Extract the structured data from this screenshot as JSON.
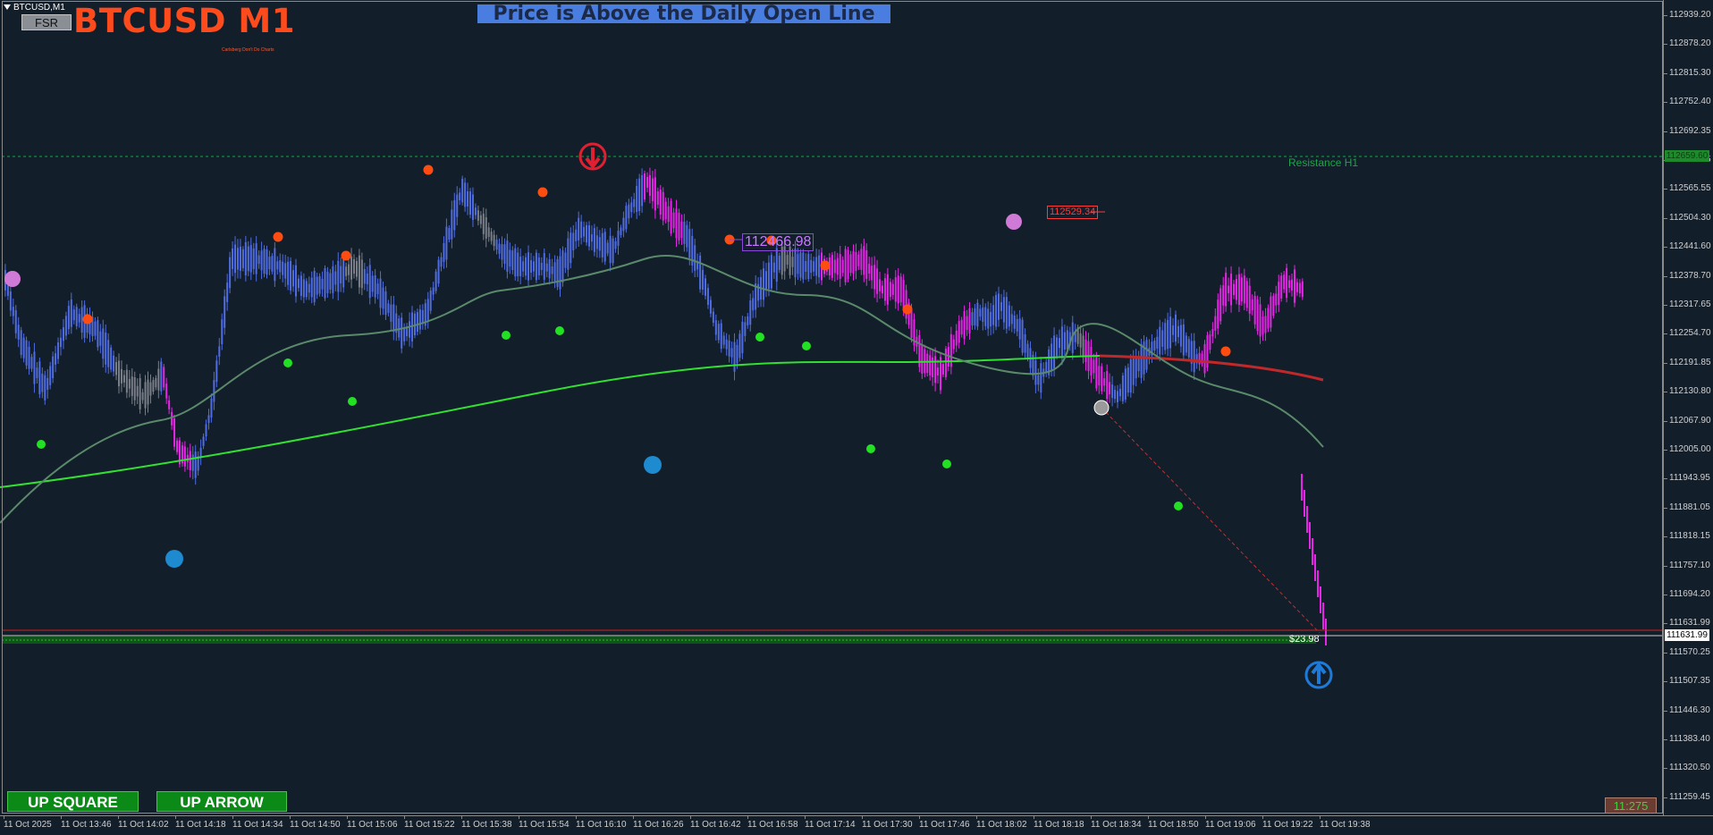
{
  "window": {
    "symbol_tab": "BTCUSD,M1",
    "fsr_button": "FSR",
    "title": "BTCUSD M1",
    "subtitle": "Carlsberg Don't Do Charts",
    "status_banner": "Price is Above the Daily Open Line"
  },
  "annotations": {
    "resistance_label": "Resistance H1",
    "price_label_1": "112466.98",
    "price_label_2": "112529.34",
    "profit_label": "$23.98",
    "bar_timer": "11:275"
  },
  "buttons": {
    "up_square": "UP SQUARE",
    "up_arrow": "UP ARROW"
  },
  "price_axis": {
    "labels": [
      "112939.20",
      "112878.20",
      "112815.30",
      "112752.40",
      "112692.35",
      "112628.45",
      "112565.55",
      "112504.30",
      "112441.60",
      "112378.70",
      "112317.65",
      "112254.70",
      "112191.85",
      "112130.80",
      "112067.90",
      "112005.00",
      "111943.95",
      "111881.05",
      "111818.15",
      "111757.10",
      "111694.20",
      "111631.99",
      "111570.25",
      "111507.35",
      "111446.30",
      "111383.40",
      "111320.50",
      "111259.45"
    ],
    "resistance_flag": "112659.60",
    "current_flag": "111631.99"
  },
  "time_axis": {
    "labels": [
      "11 Oct 2025",
      "11 Oct 13:46",
      "11 Oct 14:02",
      "11 Oct 14:18",
      "11 Oct 14:34",
      "11 Oct 14:50",
      "11 Oct 15:06",
      "11 Oct 15:22",
      "11 Oct 15:38",
      "11 Oct 15:54",
      "11 Oct 16:10",
      "11 Oct 16:26",
      "11 Oct 16:42",
      "11 Oct 16:58",
      "11 Oct 17:14",
      "11 Oct 17:30",
      "11 Oct 17:46",
      "11 Oct 18:02",
      "11 Oct 18:18",
      "11 Oct 18:34",
      "11 Oct 18:50",
      "11 Oct 19:06",
      "11 Oct 19:22",
      "11 Oct 19:38"
    ]
  },
  "colors": {
    "background": "#131e2b",
    "bull_candle": "#4f6ce0",
    "bear_candle": "#e626e6",
    "neutral_candle": "#7a7f88",
    "ma_slow": "#32e032",
    "ma_slow_bear": "#c0282a",
    "ma_fast": "#5a8a6a",
    "title": "#ff4a1c",
    "banner": "#4a7de0",
    "resistance": "#1ea34a",
    "swing_high_dot": "#ff4c10",
    "swing_low_dot": "#22e022"
  },
  "icons": {
    "sell_signal": "down-arrow-circle-icon",
    "buy_signal": "up-arrow-circle-icon",
    "swing_high": "orange-dot-icon",
    "swing_low": "green-dot-icon"
  }
}
